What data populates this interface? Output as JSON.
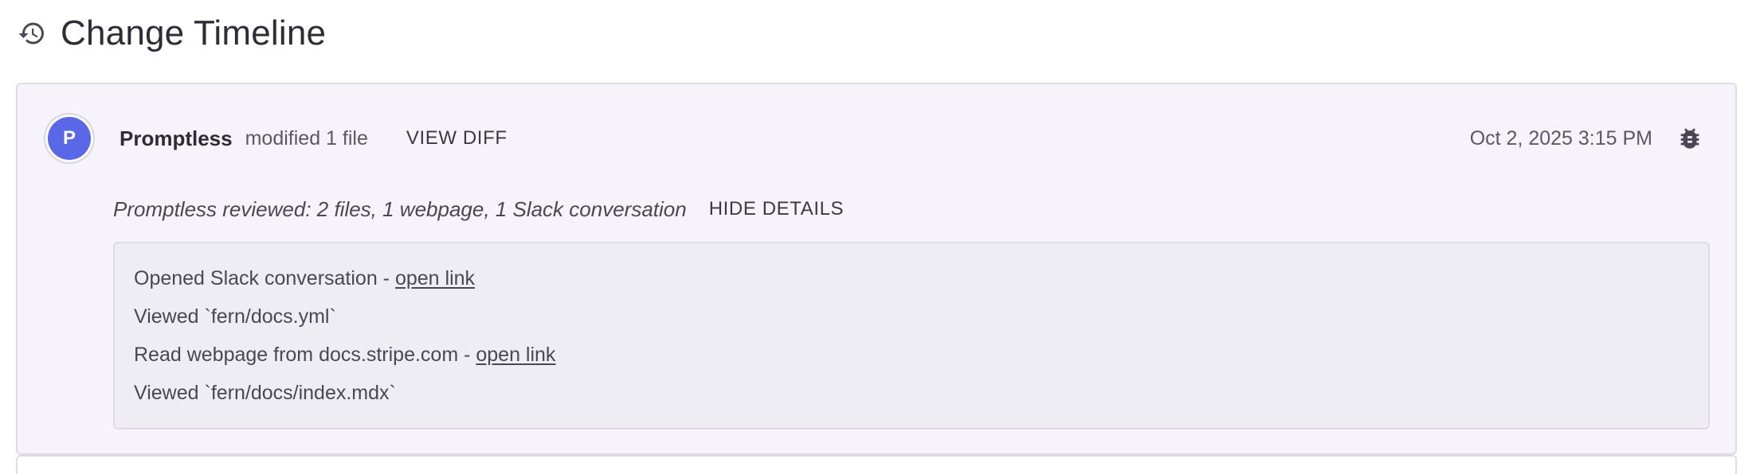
{
  "header": {
    "icon": "history-icon",
    "title": "Change Timeline"
  },
  "entry": {
    "avatar_letter": "P",
    "avatar_color": "#5a67e6",
    "author": "Promptless",
    "action": "modified 1 file",
    "view_diff_label": "VIEW DIFF",
    "timestamp": "Oct 2, 2025 3:15 PM",
    "bug_icon": "bug-icon",
    "summary": "Promptless reviewed: 2 files, 1 webpage, 1 Slack conversation",
    "hide_details_label": "HIDE DETAILS",
    "details": [
      {
        "text": "Opened Slack conversation - ",
        "link": "open link"
      },
      {
        "text": "Viewed `fern/docs.yml`",
        "link": null
      },
      {
        "text": "Read webpage from docs.stripe.com - ",
        "link": "open link"
      },
      {
        "text": "Viewed `fern/docs/index.mdx`",
        "link": null
      }
    ]
  },
  "colors": {
    "card_background": "#f6f4fa",
    "details_background": "#efedf4",
    "border": "#dedbe6"
  }
}
